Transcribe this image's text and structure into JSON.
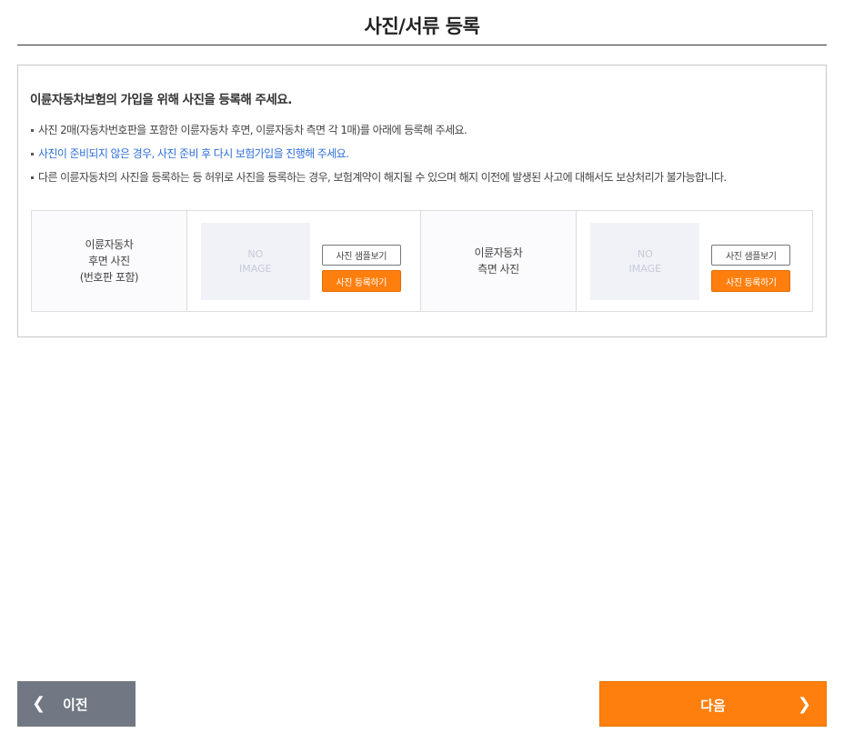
{
  "page": {
    "title": "사진/서류 등록"
  },
  "panel": {
    "heading": "이륜자동차보험의 가입을 위해 사진을 등록해 주세요.",
    "notices": [
      "사진 2매(자동차번호판을 포함한 이륜자동차 후면, 이륜자동차 측면 각 1매)를 아래에 등록해 주세요.",
      "사진이 준비되지 않은 경우, 사진 준비 후 다시 보험가입을 진행해 주세요.",
      "다른 이륜자동차의 사진을 등록하는 등 허위로 사진을 등록하는 경우, 보험계약이 해지될 수 있으며 해지 이전에 발생된 사고에 대해서도 보상처리가 불가능합니다."
    ],
    "notice_colors": {
      "highlight": "#2f6fd6"
    }
  },
  "photos": [
    {
      "label_lines": [
        "이륜자동차",
        "후면 사진",
        "(번호판 포함)"
      ],
      "placeholder_lines": [
        "NO",
        "IMAGE"
      ],
      "sample_label": "사진 샘플보기",
      "register_label": "사진 등록하기"
    },
    {
      "label_lines": [
        "이륜자동차",
        "측면 사진"
      ],
      "placeholder_lines": [
        "NO",
        "IMAGE"
      ],
      "sample_label": "사진 샘플보기",
      "register_label": "사진 등록하기"
    }
  ],
  "footer": {
    "prev_label": "이전",
    "prev_icon": "chevron-left-icon",
    "next_label": "다음",
    "next_icon": "chevron-right-icon"
  },
  "colors": {
    "accent": "#ff7f0e",
    "secondary": "#717883"
  }
}
